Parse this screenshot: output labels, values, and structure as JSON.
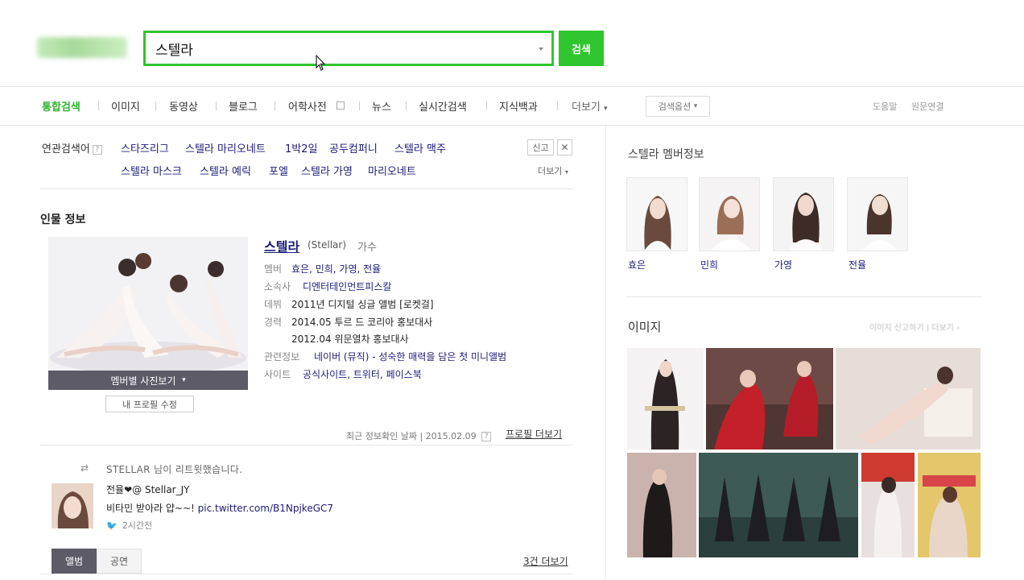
{
  "search": {
    "query": "스텔라",
    "button_label": "검색"
  },
  "tabs": [
    {
      "label": "통합검색"
    },
    {
      "label": "이미지"
    },
    {
      "label": "동영상"
    },
    {
      "label": "블로그"
    },
    {
      "label": "어학사전"
    },
    {
      "label": "뉴스"
    },
    {
      "label": "실시간검색"
    },
    {
      "label": "지식백과"
    },
    {
      "label": "더보기"
    }
  ],
  "options_label": "검색옵션",
  "header_right": [
    "도움말",
    "원문연결"
  ],
  "related": {
    "label": "연관검색어",
    "help": "?",
    "row1": [
      "스타즈리그",
      "스텔라 마리오네트",
      "1박2일",
      "공두컴퍼니",
      "스텔라 맥주"
    ],
    "row2": [
      "스텔라 마스크",
      "스텔라 예릭",
      "포엘",
      "스텔라 가영",
      "마리오네트"
    ],
    "report": "신고",
    "close": "✕",
    "more": "더보기"
  },
  "person": {
    "section": "인물 정보",
    "name": "스텔라",
    "english": "(Stellar)",
    "role": "가수",
    "member_btn": "멤버별 사진보기",
    "edit_btn": "내 프로필 수정",
    "info": [
      {
        "label": "멤버",
        "value": "효은, 민희, 가영, 전율"
      },
      {
        "label": "소속사",
        "value": "디엔터테인먼트피스칼"
      },
      {
        "label": "데뷔",
        "value": "2011년 디지털 싱글 앨범 [로켓걸]"
      },
      {
        "label": "경력",
        "value": "2014.05 투르 드 코리아 홍보대사"
      },
      {
        "label": "",
        "value": "2012.04 위문열차 홍보대사"
      },
      {
        "label": "관련정보",
        "value": "네이버 (뮤직) - 성숙한 매력을 담은 첫 미니앨범"
      },
      {
        "label": "사이트",
        "value": "공식사이트, 트위터, 페이스북"
      }
    ],
    "update_text": "최근 정보확인 날짜 | 2015.02.09",
    "profile_more": "프로필 더보기"
  },
  "tweet": {
    "retweet_text": "STELLAR 님이 리트윗했습니다.",
    "user": "전율❤@ Stellar_JY",
    "body_text": "비타민 받아라 얍~~!",
    "body_link": "pic.twitter.com/B1NpjkeGC7",
    "time": "2시간전"
  },
  "album_tabs": {
    "active": "앨범",
    "inactive": "공연",
    "more": "3건 더보기"
  },
  "right": {
    "members_title": "스텔라 멤버정보",
    "members": [
      "효은",
      "민희",
      "가영",
      "전율"
    ],
    "images_title": "이미지",
    "image_tools": "이미지 신고하기 | 더보기 ›"
  },
  "colors": {
    "accent_green": "#2ec52e",
    "link_navy": "#1b1b7a",
    "button_gray": "#5d5b66"
  }
}
